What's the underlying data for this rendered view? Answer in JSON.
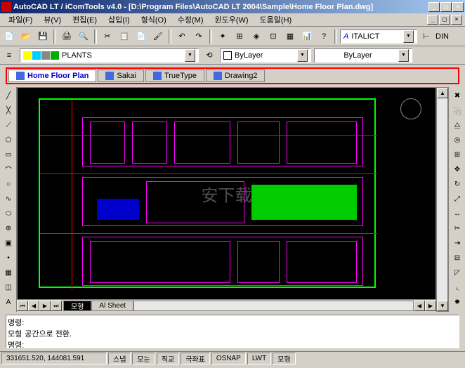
{
  "titlebar": {
    "text": "AutoCAD LT / iComTools v4.0 - [D:\\Program Files\\AutoCAD LT 2004\\Sample\\Home Floor Plan.dwg]"
  },
  "menubar": {
    "items": [
      "파일(F)",
      "뷰(V)",
      "편집(E)",
      "삽입(I)",
      "형식(O)",
      "수정(M)",
      "윈도우(W)",
      "도움말(H)"
    ]
  },
  "font_dropdown": {
    "value": "ITALICT",
    "prefix": "A"
  },
  "dim_label": "DIN",
  "layer_dropdown": {
    "value": "PLANTS"
  },
  "bylayer1": {
    "value": "ByLayer"
  },
  "bylayer2": {
    "value": "ByLayer"
  },
  "doc_tabs": [
    {
      "label": "Home Floor Plan",
      "active": true
    },
    {
      "label": "Sakai",
      "active": false
    },
    {
      "label": "TrueType",
      "active": false
    },
    {
      "label": "Drawing2",
      "active": false
    }
  ],
  "sheet_tabs": {
    "model": "모형",
    "sheet": "Al Sheet"
  },
  "command": {
    "line1_prompt": "명령:",
    "line2_prompt": "모형",
    "line2_text": "공간으로 전환.",
    "line3_prompt": "명령:"
  },
  "statusbar": {
    "coords": "331651.520, 144081.591",
    "buttons": [
      "스냅",
      "모눈",
      "직교",
      "극좌표",
      "OSNAP",
      "LWT",
      "모형"
    ]
  },
  "watermark": "安下载"
}
